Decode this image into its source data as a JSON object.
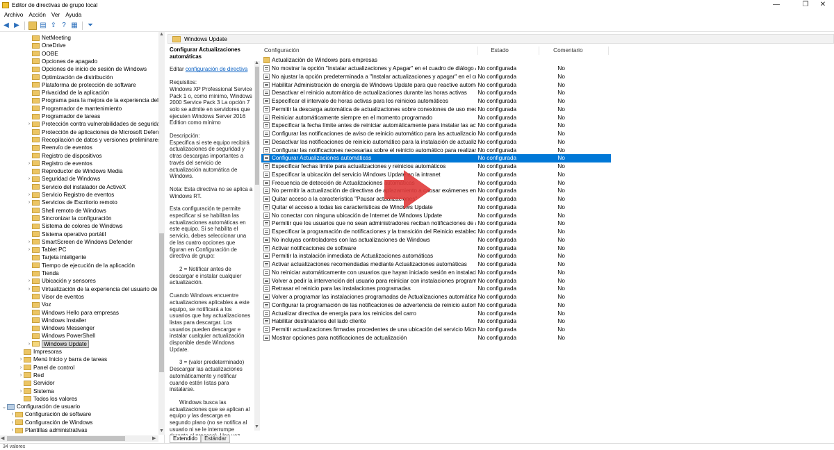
{
  "window": {
    "title": "Editor de directivas de grupo local",
    "min": "—",
    "max": "❐",
    "close": "✕"
  },
  "menu": [
    "Archivo",
    "Acción",
    "Ver",
    "Ayuda"
  ],
  "toolbar_icons": [
    "back-icon",
    "forward-icon",
    "folder-up-icon",
    "show-hide-tree-icon",
    "export-icon",
    "help-icon",
    "properties-icon",
    "filter-icon"
  ],
  "tree": [
    {
      "label": "NetMeeting",
      "level": 4,
      "exp": ""
    },
    {
      "label": "OneDrive",
      "level": 4,
      "exp": ""
    },
    {
      "label": "OOBE",
      "level": 4,
      "exp": ""
    },
    {
      "label": "Opciones de apagado",
      "level": 4,
      "exp": ""
    },
    {
      "label": "Opciones de inicio de sesión de Windows",
      "level": 4,
      "exp": ""
    },
    {
      "label": "Optimización de distribución",
      "level": 4,
      "exp": ""
    },
    {
      "label": "Plataforma de protección de software",
      "level": 4,
      "exp": ""
    },
    {
      "label": "Privacidad de la aplicación",
      "level": 4,
      "exp": ""
    },
    {
      "label": "Programa para la mejora de la experiencia del usu",
      "level": 4,
      "exp": ""
    },
    {
      "label": "Programador de mantenimiento",
      "level": 4,
      "exp": ""
    },
    {
      "label": "Programador de tareas",
      "level": 4,
      "exp": ""
    },
    {
      "label": "Protección contra vulnerabilidades de seguridad c",
      "level": 4,
      "exp": ">"
    },
    {
      "label": "Protección de aplicaciones de Microsoft Defender",
      "level": 4,
      "exp": ""
    },
    {
      "label": "Recopilación de datos y versiones preliminares",
      "level": 4,
      "exp": ""
    },
    {
      "label": "Reenvío de eventos",
      "level": 4,
      "exp": ""
    },
    {
      "label": "Registro de dispositivos",
      "level": 4,
      "exp": ""
    },
    {
      "label": "Registro de eventos",
      "level": 4,
      "exp": ">"
    },
    {
      "label": "Reproductor de Windows Media",
      "level": 4,
      "exp": ""
    },
    {
      "label": "Seguridad de Windows",
      "level": 4,
      "exp": ">"
    },
    {
      "label": "Servicio del instalador de ActiveX",
      "level": 4,
      "exp": ""
    },
    {
      "label": "Servicio Registro de eventos",
      "level": 4,
      "exp": ">"
    },
    {
      "label": "Servicios de Escritorio remoto",
      "level": 4,
      "exp": ">"
    },
    {
      "label": "Shell remoto de Windows",
      "level": 4,
      "exp": ""
    },
    {
      "label": "Sincronizar la configuración",
      "level": 4,
      "exp": ""
    },
    {
      "label": "Sistema de colores de Windows",
      "level": 4,
      "exp": ""
    },
    {
      "label": "Sistema operativo portátil",
      "level": 4,
      "exp": ""
    },
    {
      "label": "SmartScreen de Windows Defender",
      "level": 4,
      "exp": ">"
    },
    {
      "label": "Tablet PC",
      "level": 4,
      "exp": ">"
    },
    {
      "label": "Tarjeta inteligente",
      "level": 4,
      "exp": ""
    },
    {
      "label": "Tiempo de ejecución de la aplicación",
      "level": 4,
      "exp": ""
    },
    {
      "label": "Tienda",
      "level": 4,
      "exp": ""
    },
    {
      "label": "Ubicación y sensores",
      "level": 4,
      "exp": ">"
    },
    {
      "label": "Virtualización de la experiencia del usuario de Mic",
      "level": 4,
      "exp": ">"
    },
    {
      "label": "Visor de eventos",
      "level": 4,
      "exp": ""
    },
    {
      "label": "Voz",
      "level": 4,
      "exp": ""
    },
    {
      "label": "Windows Hello para empresas",
      "level": 4,
      "exp": ""
    },
    {
      "label": "Windows Installer",
      "level": 4,
      "exp": ""
    },
    {
      "label": "Windows Messenger",
      "level": 4,
      "exp": ""
    },
    {
      "label": "Windows PowerShell",
      "level": 4,
      "exp": ""
    },
    {
      "label": "Windows Update",
      "level": 4,
      "exp": ">",
      "selected": true
    },
    {
      "label": "Impresoras",
      "level": 3,
      "exp": ""
    },
    {
      "label": "Menú Inicio y barra de tareas",
      "level": 3,
      "exp": ">"
    },
    {
      "label": "Panel de control",
      "level": 3,
      "exp": ">"
    },
    {
      "label": "Red",
      "level": 3,
      "exp": ">"
    },
    {
      "label": "Servidor",
      "level": 3,
      "exp": ""
    },
    {
      "label": "Sistema",
      "level": 3,
      "exp": ">"
    },
    {
      "label": "Todos los valores",
      "level": 3,
      "exp": ""
    },
    {
      "label": "Configuración de usuario",
      "level": 1,
      "exp": "v",
      "pc": true
    },
    {
      "label": "Configuración de software",
      "level": 2,
      "exp": ">"
    },
    {
      "label": "Configuración de Windows",
      "level": 2,
      "exp": ">"
    },
    {
      "label": "Plantillas administrativas",
      "level": 2,
      "exp": ">"
    }
  ],
  "right": {
    "header": "Windows Update",
    "desc": {
      "title": "Configurar Actualizaciones automáticas",
      "edit_prefix": "Editar",
      "edit_link": "configuración de directiva",
      "paragraphs": [
        "Requisitos:\nWindows XP Professional Service Pack 1 o, como mínimo, Windows 2000 Service Pack 3 La opción 7 solo se admite en servidores que ejecuten Windows Server 2016 Edition como mínimo",
        "Descripción:\nEspecifica si este equipo recibirá actualizaciones de seguridad y otras descargas importantes a través del servicio de actualización automática de Windows.",
        "Nota: Esta directiva no se aplica a Windows RT.",
        "Esta configuración te permite especificar si se habilitan las actualizaciones automáticas en este equipo. Si se habilita el servicio, debes seleccionar una de las cuatro opciones que figuran en Configuración de directiva de grupo:",
        "2 = Notificar antes de descargar e instalar cualquier actualización.",
        "Cuando Windows encuentre actualizaciones aplicables a este equipo, se notificará a los usuarios que hay actualizaciones listas para descargar. Los usuarios pueden descargar e instalar cualquier actualización disponible desde Windows Update.",
        "3 = (valor predeterminado) Descargar las actualizaciones automáticamente y notificar cuando estén listas para instalarse.",
        "Windows busca las actualizaciones que se aplican al equipo y las descarga en segundo plano (no se notifica al usuario ni se le interrumpe durante el proceso). Una vez completadas las descargas, se notifica a los usuarios que están listas para instalarse. Los usuarios pueden"
      ]
    },
    "columns": [
      "Configuración",
      "Estado",
      "Comentario"
    ],
    "rows": [
      {
        "name": "Actualización de Windows para empresas",
        "state": "",
        "comment": "",
        "folder": true
      },
      {
        "name": "No mostrar la opción \"Instalar actualizaciones y Apagar\" en el cuadro de diálogo Apagar...",
        "state": "No configurada",
        "comment": "No"
      },
      {
        "name": "No ajustar la opción predeterminada a \"Instalar actualizaciones y apagar\" en el cuadro d...",
        "state": "No configurada",
        "comment": "No"
      },
      {
        "name": "Habilitar Administración de energía de Windows Update para que reactive automáticamen...",
        "state": "No configurada",
        "comment": "No"
      },
      {
        "name": "Desactivar el reinicio automático de actualizaciones durante las horas activas",
        "state": "No configurada",
        "comment": "No"
      },
      {
        "name": "Especificar el intervalo de horas activas para los reinicios automáticos",
        "state": "No configurada",
        "comment": "No"
      },
      {
        "name": "Permitir la descarga automática de actualizaciones sobre conexiones de uso medido",
        "state": "No configurada",
        "comment": "No"
      },
      {
        "name": "Reiniciar automáticamente siempre en el momento programado",
        "state": "No configurada",
        "comment": "No"
      },
      {
        "name": "Especificar la fecha límite antes de reiniciar automáticamente para instalar las actualizaci...",
        "state": "No configurada",
        "comment": "No"
      },
      {
        "name": "Configurar las notificaciones de aviso de reinicio automático para las actualizaciones",
        "state": "No configurada",
        "comment": "No"
      },
      {
        "name": "Desactivar las notificaciones de reinicio automático para la instalación de actualizaciones",
        "state": "No configurada",
        "comment": "No"
      },
      {
        "name": "Configurar las notificaciones necesarias sobre el reinicio automático para realizar actuali...",
        "state": "No configurada",
        "comment": "No"
      },
      {
        "name": "Configurar Actualizaciones automáticas",
        "state": "No configurada",
        "comment": "No",
        "selected": true
      },
      {
        "name": "Especificar fechas límite para actualizaciones y reinicios automáticos",
        "state": "No configurada",
        "comment": "No"
      },
      {
        "name": "Especificar la ubicación del servicio Windows Update en la intranet",
        "state": "No configurada",
        "comment": "No"
      },
      {
        "name": "Frecuencia de detección de Actualizaciones automáticas",
        "state": "No configurada",
        "comment": "No"
      },
      {
        "name": "No permitir la actualización de directivas de aplazamiento a causar exámenes en Windo...",
        "state": "No configurada",
        "comment": "No"
      },
      {
        "name": "Quitar acceso a la característica \"Pausar actualizaciones\"",
        "state": "No configurada",
        "comment": "No"
      },
      {
        "name": "Quitar el acceso a todas las características de Windows Update",
        "state": "No configurada",
        "comment": "No"
      },
      {
        "name": "No conectar con ninguna ubicación de Internet de Windows Update",
        "state": "No configurada",
        "comment": "No"
      },
      {
        "name": "Permitir que los usuarios que no sean administradores reciban notificaciones de actualiz...",
        "state": "No configurada",
        "comment": "No"
      },
      {
        "name": "Especificar la programación de notificaciones y la transición del Reinicio establecido par...",
        "state": "No configurada",
        "comment": "No"
      },
      {
        "name": "No incluyas controladores con las actualizaciones de Windows",
        "state": "No configurada",
        "comment": "No"
      },
      {
        "name": "Activar notificaciones de software",
        "state": "No configurada",
        "comment": "No"
      },
      {
        "name": "Permitir la instalación inmediata de Actualizaciones automáticas",
        "state": "No configurada",
        "comment": "No"
      },
      {
        "name": "Activar actualizaciones recomendadas mediante Actualizaciones automáticas",
        "state": "No configurada",
        "comment": "No"
      },
      {
        "name": "No reiniciar automáticamente con usuarios que hayan iniciado sesión en instalaciones de...",
        "state": "No configurada",
        "comment": "No"
      },
      {
        "name": "Volver a pedir la intervención del usuario para reiniciar con instalaciones programadas",
        "state": "No configurada",
        "comment": "No"
      },
      {
        "name": "Retrasar el reinicio para las instalaciones programadas",
        "state": "No configurada",
        "comment": "No"
      },
      {
        "name": "Volver a programar las instalaciones programadas de Actualizaciones automáticas",
        "state": "No configurada",
        "comment": "No"
      },
      {
        "name": "Configurar la programación de las notificaciones de advertencia de reinicio automático ...",
        "state": "No configurada",
        "comment": "No"
      },
      {
        "name": "Actualizar directiva de energía para los reinicios del carro",
        "state": "No configurada",
        "comment": "No"
      },
      {
        "name": "Habilitar destinatarios del lado cliente",
        "state": "No configurada",
        "comment": "No"
      },
      {
        "name": "Permitir actualizaciones firmadas procedentes de una ubicación del servicio Microsoft U...",
        "state": "No configurada",
        "comment": "No"
      },
      {
        "name": "Mostrar opciones para notificaciones de actualización",
        "state": "No configurada",
        "comment": "No"
      }
    ],
    "tabs": [
      "Extendido",
      "Estándar"
    ]
  },
  "status": "34 valores",
  "colors": {
    "selection": "#0078d7",
    "arrow": "#e03b3b",
    "link": "#0b62c4"
  }
}
